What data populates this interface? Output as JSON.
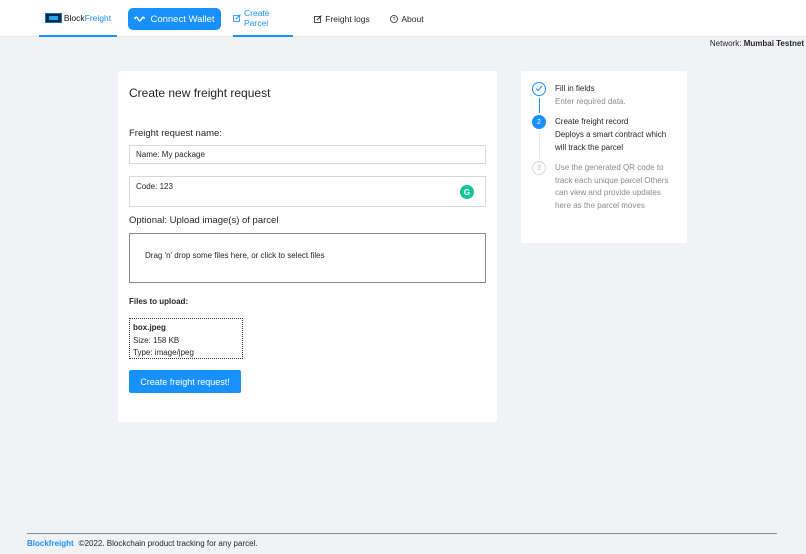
{
  "header": {
    "logo_text_a": "Block",
    "logo_text_b": "Freight",
    "connect_label": "Connect Wallet",
    "nav": {
      "create_parcel": "Create Parcel",
      "freight_logs": "Freight logs",
      "about": "About"
    }
  },
  "network": {
    "label": "Network:",
    "value": "Mumbai Testnet"
  },
  "form": {
    "title": "Create new freight request",
    "name_label": "Freight request name:",
    "name_value": "Name: My package",
    "code_value": "Code: 123",
    "upload_label": "Optional: Upload image(s) of parcel",
    "dropzone_text": "Drag 'n' drop some files here, or click to select files",
    "files_label": "Files to upload:",
    "file": {
      "name": "box.jpeg",
      "size": "Size: 158 KB",
      "type": "Type: image/jpeg"
    },
    "submit_label": "Create freight request!"
  },
  "steps": [
    {
      "title": "Fill in fields",
      "description": "Enter required data.",
      "number": "1",
      "status": "finished"
    },
    {
      "title": "Create freight record",
      "description": "Deploys a smart contract which will track the parcel",
      "number": "2",
      "status": "process"
    },
    {
      "title": "",
      "description": "Use the generated QR code to track each unique parcel Others can view and provide updates here as the parcel moves",
      "number": "3",
      "status": "wait"
    }
  ],
  "footer": {
    "brand": "Blockfreight",
    "text": "©2022. Blockchain product tracking for any parcel."
  },
  "colors": {
    "primary": "#1890ff",
    "background": "#f0f2f5",
    "grammarly": "#15c39a"
  },
  "icons": {
    "connect": "wave-icon",
    "create_parcel": "edit-icon",
    "freight_logs": "edit-icon",
    "about": "question-circle-icon",
    "step1": "check-icon",
    "grammarly": "grammarly-icon"
  }
}
